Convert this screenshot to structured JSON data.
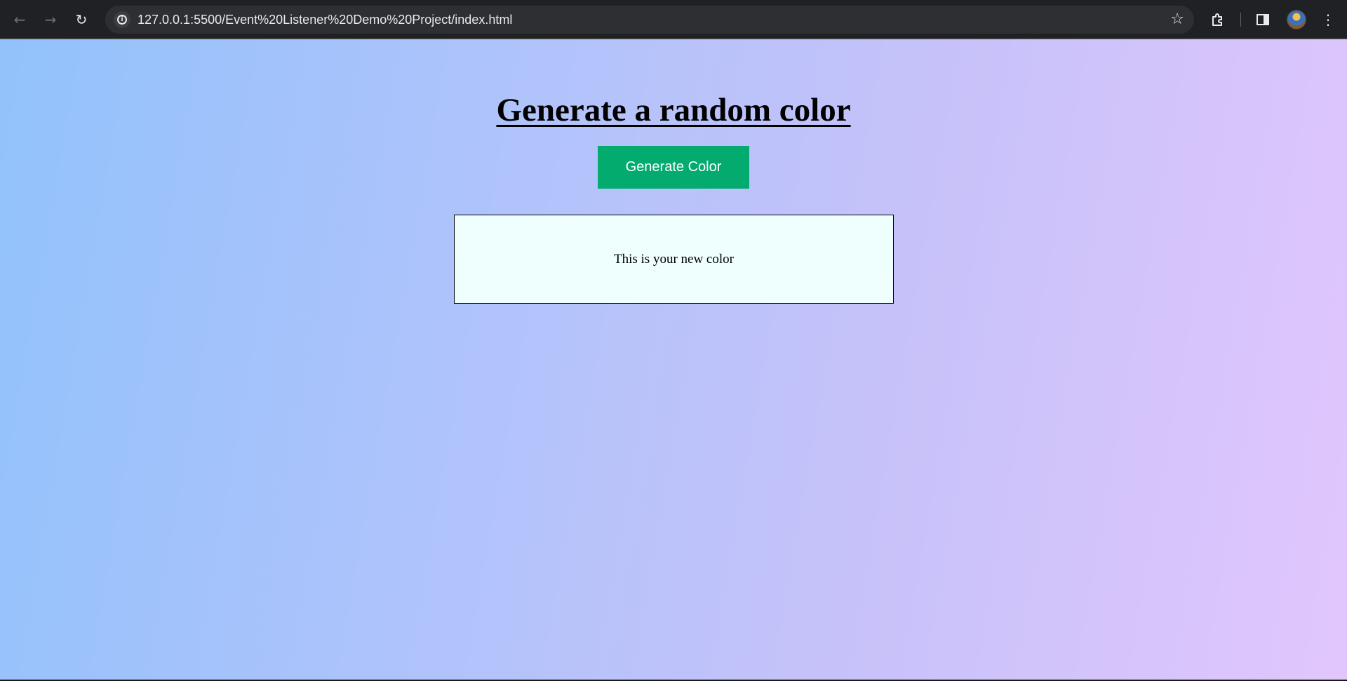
{
  "browser": {
    "url": "127.0.0.1:5500/Event%20Listener%20Demo%20Project/index.html",
    "back_icon": "←",
    "forward_icon": "→",
    "reload_icon": "↻",
    "bookmark_icon": "☆",
    "extensions_icon": "⧉",
    "sidepanel_icon": "◨",
    "menu_icon": "⋮"
  },
  "page": {
    "title": "Generate a random color",
    "button_label": "Generate Color",
    "box_text": "This is your new color"
  },
  "colors": {
    "button": "#03ab6f",
    "box_background": "#eefffd",
    "gradient_start": "#92c2fb",
    "gradient_end": "#e1c6fd"
  }
}
